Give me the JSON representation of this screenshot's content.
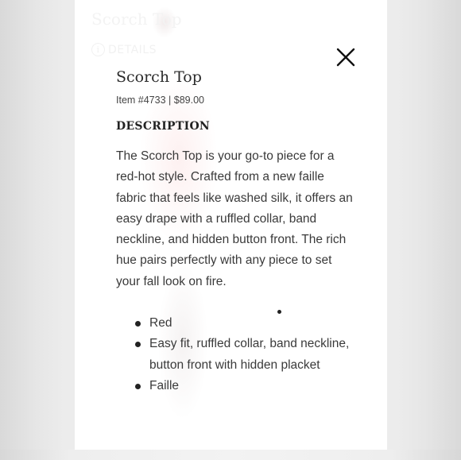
{
  "background": {
    "ghost_title": "Scorch Top",
    "ghost_details_label": "DETAILS"
  },
  "product": {
    "title": "Scorch Top",
    "item_line": "Item #4733 | $89.00"
  },
  "description": {
    "heading": "DESCRIPTION",
    "body": "The Scorch Top is your go-to piece for a red-hot style. Crafted from a new faille fabric that feels like washed silk, it offers an easy drape with a ruffled collar, band neckline, and hidden button front. The rich hue pairs perfectly with any piece to set your fall look on fire."
  },
  "features": [
    {
      "text": "Red"
    },
    {
      "text": "Easy fit, ruffled collar, band neckline, button front with hidden placket"
    },
    {
      "text": "Faille"
    }
  ],
  "icons": {
    "close": "close-icon",
    "info": "info-icon"
  },
  "colors": {
    "text": "#3a3a3a",
    "heading": "#222222",
    "panel": "#ffffff"
  }
}
